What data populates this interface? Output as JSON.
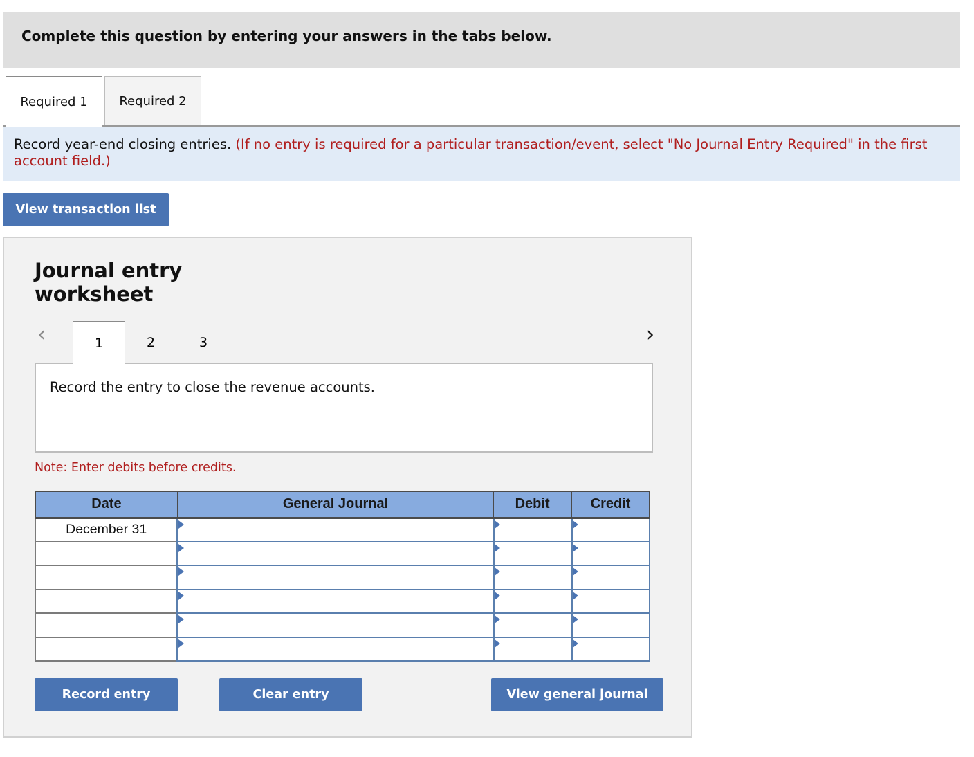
{
  "header": {
    "text": "Complete this question by entering your answers in the tabs below."
  },
  "tabs": [
    {
      "label": "Required 1",
      "active": true
    },
    {
      "label": "Required 2",
      "active": false
    }
  ],
  "instructions": {
    "main": "Record year-end closing entries.",
    "note": "(If no entry is required for a particular transaction/event, select \"No Journal Entry Required\" in the first account field.)"
  },
  "view_transaction_list_label": "View transaction list",
  "worksheet": {
    "title_line1": "Journal entry",
    "title_line2": "worksheet",
    "pages": [
      "1",
      "2",
      "3"
    ],
    "active_page": "1",
    "prev_icon": "‹",
    "next_icon": "›",
    "entry_description": "Record the entry to close the revenue accounts.",
    "note": "Note: Enter debits before credits.",
    "table": {
      "headers": [
        "Date",
        "General Journal",
        "Debit",
        "Credit"
      ],
      "rows": [
        {
          "date": "December 31",
          "account": "",
          "debit": "",
          "credit": ""
        },
        {
          "date": "",
          "account": "",
          "debit": "",
          "credit": ""
        },
        {
          "date": "",
          "account": "",
          "debit": "",
          "credit": ""
        },
        {
          "date": "",
          "account": "",
          "debit": "",
          "credit": ""
        },
        {
          "date": "",
          "account": "",
          "debit": "",
          "credit": ""
        },
        {
          "date": "",
          "account": "",
          "debit": "",
          "credit": ""
        }
      ]
    },
    "buttons": {
      "record": "Record entry",
      "clear": "Clear entry",
      "view_journal": "View general journal"
    }
  },
  "colors": {
    "button": "#4a74b3",
    "table_header": "#87abdf",
    "red_text": "#b01e1e",
    "instruction_bg": "#e1ebf7"
  }
}
